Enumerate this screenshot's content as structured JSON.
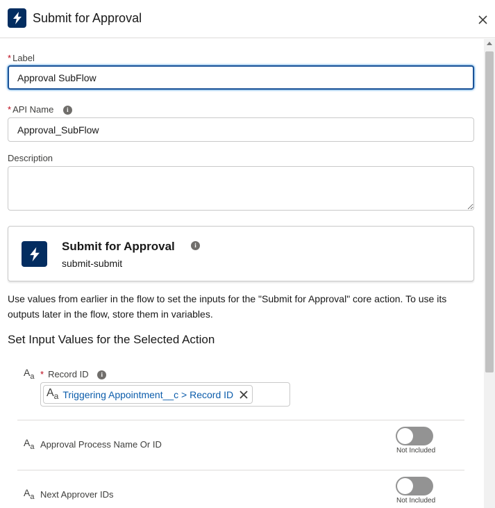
{
  "header": {
    "title": "Submit for Approval",
    "icon": "lightning-icon",
    "icon_bg": "#032d60"
  },
  "form": {
    "label": {
      "required_mark": "*",
      "label": "Label",
      "value": "Approval SubFlow"
    },
    "api_name": {
      "required_mark": "*",
      "label": "API Name",
      "value": "Approval_SubFlow"
    },
    "description": {
      "label": "Description",
      "value": ""
    }
  },
  "action_card": {
    "title": "Submit for Approval",
    "subtitle": "submit-submit"
  },
  "help_text": "Use values from earlier in the flow to set the inputs for the \"Submit for Approval\" core action. To use its outputs later in the flow, store them in variables.",
  "section_title": "Set Input Values for the Selected Action",
  "inputs": {
    "record_id": {
      "required_mark": "*",
      "label": "Record ID",
      "pill_text": "Triggering Appointment__c > Record ID"
    },
    "approval_process": {
      "label": "Approval Process Name Or ID",
      "toggle_text": "Not Included",
      "included": false
    },
    "next_approver": {
      "label": "Next Approver IDs",
      "toggle_text": "Not Included",
      "included": false
    }
  },
  "type_icon": {
    "big": "A",
    "small": "a"
  },
  "info_glyph": "i"
}
